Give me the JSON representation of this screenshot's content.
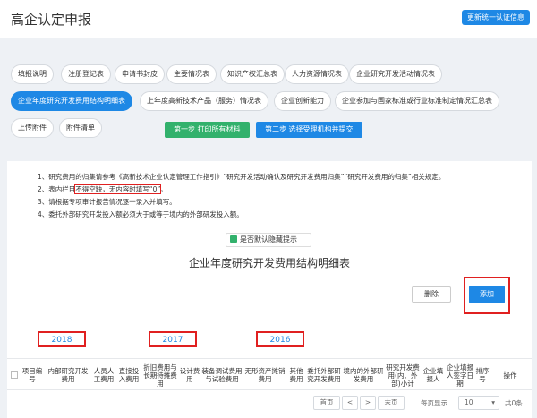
{
  "header": {
    "title": "高企认定申报",
    "update_button": "更新统一认证信息"
  },
  "tabs": [
    "填报说明",
    "注册登记表",
    "申请书封皮",
    "主要情况表",
    "知识产权汇总表",
    "人力资源情况表",
    "企业研究开发活动情况表",
    "企业年度研究开发费用结构明细表",
    "上年度高新技术产品（服务）情况表",
    "企业创新能力",
    "企业参加与国家标准或行业标准制定情况汇总表",
    "上传附件",
    "附件清单"
  ],
  "actions": {
    "step1": "第一步 打印所有材料",
    "step2": "第二步 选择受理机构并提交"
  },
  "notes": [
    "1、研究费用的归集请参考《高新技术企业认定管理工作指引》“研究开发活动确认及研究开发费用归集”“研究开发费用的归集”相关规定。",
    "2、表内栏目",
    "不得空缺，无内容时填写“0”",
    "。",
    "3、请根据专项审计报告情况逐一录入并填写。",
    "4、委托外部研究开发投入额必须大于或等于境内的外部研发投入额。"
  ],
  "hide_checkbox": "是否默认隐藏提示",
  "section_title": "企业年度研究开发费用结构明细表",
  "buttons": {
    "delete": "删除",
    "add": "添加"
  },
  "years": [
    "2018",
    "2017",
    "2016"
  ],
  "table_headers": [
    "项目编号",
    "内部研究开发费用",
    "人员人工费用",
    "直接投入费用",
    "折旧费用与长期待摊费用",
    "设计费用",
    "装备调试费用与试验费用",
    "无形资产摊销费用",
    "其他费用",
    "委托外部研究开发费用",
    "境内的外部研发费用",
    "研究开发费用(内、外部)小计",
    "企业填报人",
    "企业填报人签字日期",
    "排序号",
    "操作"
  ],
  "pager": {
    "first": "首页",
    "prev": "<",
    "next": ">",
    "last": "末页",
    "per_page_label": "每页显示",
    "per_page": "10",
    "total": "共0条"
  }
}
